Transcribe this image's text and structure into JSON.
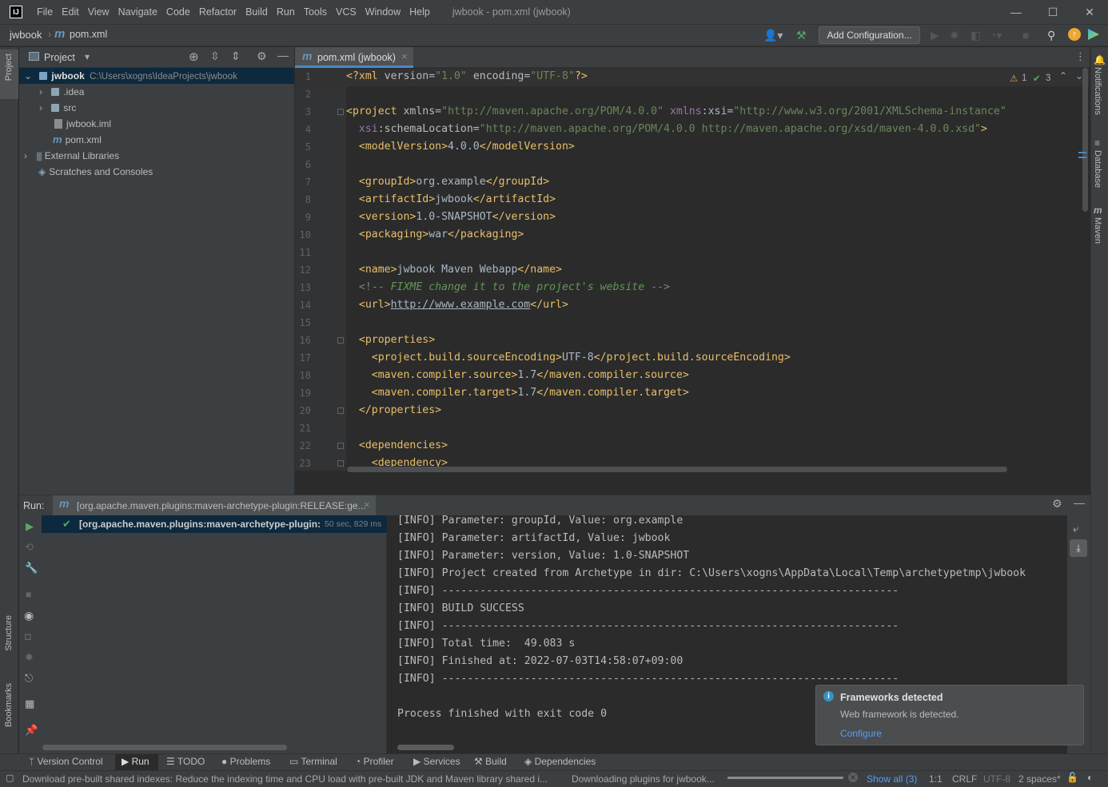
{
  "app": {
    "logo": "IJ",
    "window_title": "jwbook - pom.xml (jwbook)",
    "menu": [
      "File",
      "Edit",
      "View",
      "Navigate",
      "Code",
      "Refactor",
      "Build",
      "Run",
      "Tools",
      "VCS",
      "Window",
      "Help"
    ],
    "minimize": "—",
    "maximize": "☐",
    "close": "✕"
  },
  "breadcrumb": {
    "project": "jwbook",
    "file_icon": "m",
    "file": "pom.xml"
  },
  "toolbar": {
    "add_configuration": "Add Configuration..."
  },
  "left_tool_window": {
    "project": "Project",
    "structure": "Structure",
    "bookmarks": "Bookmarks"
  },
  "right_tool_window": {
    "notifications": "Notifications",
    "database": "Database",
    "maven": "Maven"
  },
  "project_panel": {
    "title": "Project",
    "tree": [
      {
        "label": "jwbook",
        "path": "C:\\Users\\xogns\\IdeaProjects\\jwbook"
      },
      {
        "label": ".idea"
      },
      {
        "label": "src"
      },
      {
        "label": "jwbook.iml"
      },
      {
        "label": "pom.xml"
      },
      {
        "label": "External Libraries"
      },
      {
        "label": "Scratches and Consoles"
      }
    ]
  },
  "editor": {
    "tab_label": "pom.xml (jwbook)",
    "tab_close": "×",
    "warnings": "1",
    "weak_warnings": "3",
    "line_numbers": [
      "1",
      "2",
      "3",
      "4",
      "5",
      "6",
      "7",
      "8",
      "9",
      "10",
      "11",
      "12",
      "13",
      "14",
      "15",
      "16",
      "17",
      "18",
      "19",
      "20",
      "21",
      "22",
      "23"
    ],
    "lines": [
      {
        "a": "<?xml ",
        "b": "version",
        "c": "=",
        "d": "\"1.0\"",
        "e": " encoding",
        "f": "=",
        "g": "\"UTF-8\"",
        "h": "?>"
      },
      {},
      {
        "a": "<project ",
        "b": "xmlns",
        "c": "=",
        "d": "\"http://maven.apache.org/POM/4.0.0\"",
        "e": " xmlns",
        "f": ":xsi=",
        "g": "\"http://www.w3.org/2001/XMLSchema-instance\"",
        "h": ""
      },
      {
        "a": "  ",
        "b": "xsi",
        "c": ":schemaLocation=",
        "d": "\"http://maven.apache.org/POM/4.0.0 http://maven.apache.org/xsd/maven-4.0.0.xsd\"",
        "e": ">",
        "f": "",
        "g": "",
        "h": ""
      },
      {
        "a": "  <modelVersion>",
        "b": "4.0.0",
        "c": "</modelVersion>"
      },
      {},
      {
        "a": "  <groupId>",
        "b": "org.example",
        "c": "</groupId>"
      },
      {
        "a": "  <artifactId>",
        "b": "jwbook",
        "c": "</artifactId>"
      },
      {
        "a": "  <version>",
        "b": "1.0-SNAPSHOT",
        "c": "</version>"
      },
      {
        "a": "  <packaging>",
        "b": "war",
        "c": "</packaging>"
      },
      {},
      {
        "a": "  <name>",
        "b": "jwbook Maven Webapp",
        "c": "</name>"
      },
      {
        "a": "  <!-- ",
        "b": "FIXME change it to the project's website",
        "c": " -->"
      },
      {
        "a": "  <url>",
        "b": "http://www.example.com",
        "c": "</url>"
      },
      {},
      {
        "a": "  <properties>",
        "b": "",
        "c": ""
      },
      {
        "a": "    <project.build.sourceEncoding>",
        "b": "UTF-8",
        "c": "</project.build.sourceEncoding>"
      },
      {
        "a": "    <maven.compiler.source>",
        "b": "1.7",
        "c": "</maven.compiler.source>"
      },
      {
        "a": "    <maven.compiler.target>",
        "b": "1.7",
        "c": "</maven.compiler.target>"
      },
      {
        "a": "  </properties>",
        "b": "",
        "c": ""
      },
      {},
      {
        "a": "  <dependencies>",
        "b": "",
        "c": ""
      },
      {
        "a": "    <dependency>",
        "b": "",
        "c": ""
      }
    ]
  },
  "run_panel": {
    "label": "Run:",
    "tab_icon": "m",
    "tab_label": "[org.apache.maven.plugins:maven-archetype-plugin:RELEASE:ge...",
    "tab_close": "×",
    "tree_item": "[org.apache.maven.plugins:maven-archetype-plugin:",
    "tree_time": "50 sec, 829 ms",
    "console": [
      "[INFO] Parameter: groupId, Value: org.example",
      "[INFO] Parameter: artifactId, Value: jwbook",
      "[INFO] Parameter: version, Value: 1.0-SNAPSHOT",
      "[INFO] Project created from Archetype in dir: C:\\Users\\xogns\\AppData\\Local\\Temp\\archetypetmp\\jwbook",
      "[INFO] ------------------------------------------------------------------------",
      "[INFO] BUILD SUCCESS",
      "[INFO] ------------------------------------------------------------------------",
      "[INFO] Total time:  49.083 s",
      "[INFO] Finished at: 2022-07-03T14:58:07+09:00",
      "[INFO] ------------------------------------------------------------------------",
      "",
      "Process finished with exit code 0"
    ]
  },
  "notification": {
    "title": "Frameworks detected",
    "body": "Web framework is detected.",
    "action": "Configure"
  },
  "bottom_tabs": [
    "Version Control",
    "Run",
    "TODO",
    "Problems",
    "Terminal",
    "Profiler",
    "Services",
    "Build",
    "Dependencies"
  ],
  "status_bar": {
    "message": "Download pre-built shared indexes: Reduce the indexing time and CPU load with pre-built JDK and Maven library shared i...",
    "progress_label": "Downloading plugins for jwbook...",
    "show_all": "Show all (3)",
    "position": "1:1",
    "line_sep": "CRLF",
    "encoding": "UTF-8",
    "indent": "2 spaces*"
  },
  "colors": {
    "accent": "#4a88c7",
    "success": "#59a869",
    "link": "#589df6",
    "warning": "#f0a732"
  }
}
